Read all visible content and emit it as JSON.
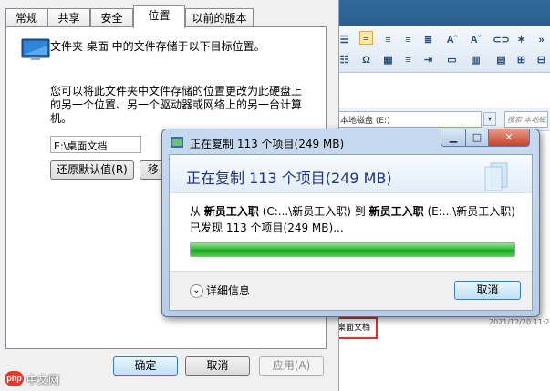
{
  "background_window": {
    "address": "本地磁盘 (E:)",
    "search_placeholder": "搜索 本地磁盘",
    "file_name": "桌面文档",
    "file_date": "2021/12/20 11:2"
  },
  "properties": {
    "tabs": [
      "常规",
      "共享",
      "安全",
      "位置",
      "以前的版本"
    ],
    "selected_tab": "位置",
    "description": "文件夹 桌面 中的文件存储于以下目标位置。",
    "explanation_line1": "您可以将此文件夹中文件存储的位置更改为此硬盘上",
    "explanation_line2": "的另一个位置、另一个驱动器或网络上的另一台计算",
    "explanation_line3": "机。",
    "path_value": "E:\\桌面文档",
    "restore_default_label": "还原默认值(R)",
    "move_label": "移",
    "ok_label": "确定",
    "cancel_label": "取消",
    "apply_label": "应用(A)"
  },
  "copy_dialog": {
    "title": "正在复制 113 个项目(249 MB)",
    "heading": "正在复制 113 个项目(249 MB)",
    "from_prefix": "从",
    "from_name": "新员工入职",
    "from_path": "(C:...\\新员工入职)",
    "to_prefix": "到",
    "to_name": "新员工入职",
    "to_path": "(E:...\\新员工入职)",
    "found_text": "已发现 113 个项目(249 MB)...",
    "progress": 1.0,
    "details_label": "详细信息",
    "cancel_label": "取消",
    "min_icon": "minimize-icon",
    "max_icon": "maximize-icon",
    "close_icon": "close-icon"
  },
  "watermark": {
    "logo_text": "php",
    "text": "中文网"
  },
  "colors": {
    "progress_green": "#1ca21c",
    "heading_blue": "#1e3287",
    "close_red": "#c7412b"
  }
}
